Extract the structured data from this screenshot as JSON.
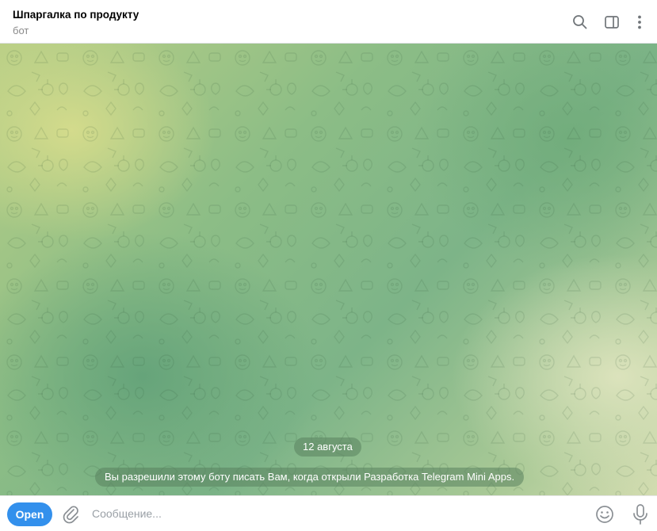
{
  "header": {
    "title": "Шпаргалка по продукту",
    "subtitle": "бот",
    "icons": [
      "search-icon",
      "sidebar-toggle-icon",
      "more-vertical-icon"
    ]
  },
  "chat": {
    "date_label": "12 августа",
    "service_message": "Вы разрешили этому боту писать Вам, когда открыли Разработка Telegram Mini Apps."
  },
  "composer": {
    "open_label": "Open",
    "placeholder": "Сообщение...",
    "icons": [
      "attach-icon",
      "emoji-icon",
      "microphone-icon"
    ]
  },
  "colors": {
    "accent": "#3390ec",
    "pill_background": "#59825e",
    "wallpaper_light": "#d6dc8c",
    "wallpaper_dark": "#60a078"
  }
}
